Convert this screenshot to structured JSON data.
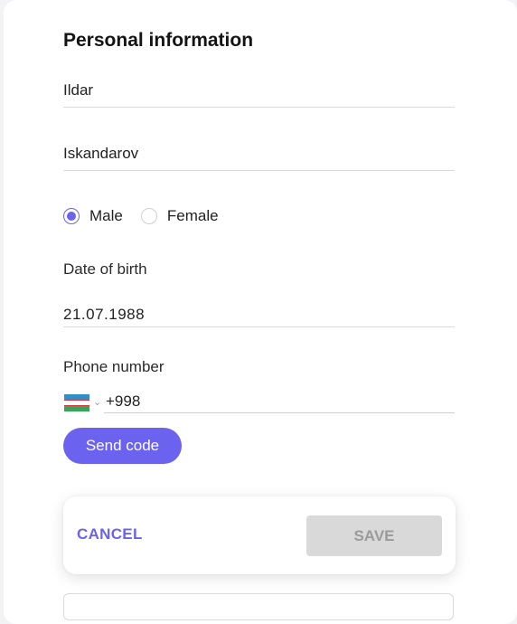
{
  "form": {
    "title": "Personal information",
    "first_name": "Ildar",
    "last_name": "Iskandarov",
    "gender": {
      "options": [
        "Male",
        "Female"
      ],
      "selected": "Male"
    },
    "dob_label": "Date of birth",
    "dob_value": "21.07.1988",
    "phone_label": "Phone number",
    "phone_country_icon": "uzbekistan-flag-icon",
    "phone_code": "+998",
    "send_code_label": "Send code"
  },
  "actions": {
    "cancel_label": "CANCEL",
    "save_label": "SAVE"
  },
  "colors": {
    "accent": "#6b63f0",
    "save_disabled_bg": "#d9d9d9"
  }
}
